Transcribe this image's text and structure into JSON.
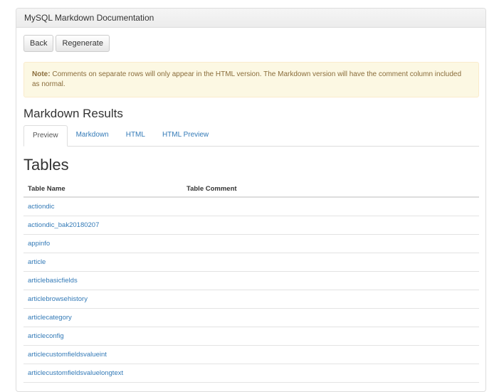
{
  "panel": {
    "title": "MySQL Markdown Documentation"
  },
  "buttons": {
    "back": "Back",
    "regenerate": "Regenerate"
  },
  "alert": {
    "label": "Note:",
    "text": " Comments on separate rows will only appear in the HTML version. The Markdown version will have the comment column included as normal."
  },
  "results": {
    "title": "Markdown Results",
    "tabs": [
      {
        "label": "Preview",
        "active": true
      },
      {
        "label": "Markdown",
        "active": false
      },
      {
        "label": "HTML",
        "active": false
      },
      {
        "label": "HTML Preview",
        "active": false
      }
    ]
  },
  "tables": {
    "title": "Tables",
    "columns": [
      "Table Name",
      "Table Comment"
    ],
    "rows": [
      {
        "name": "actiondic",
        "comment": ""
      },
      {
        "name": "actiondic_bak20180207",
        "comment": ""
      },
      {
        "name": "appinfo",
        "comment": ""
      },
      {
        "name": "article",
        "comment": ""
      },
      {
        "name": "articlebasicfields",
        "comment": ""
      },
      {
        "name": "articlebrowsehistory",
        "comment": ""
      },
      {
        "name": "articlecategory",
        "comment": ""
      },
      {
        "name": "articleconfig",
        "comment": ""
      },
      {
        "name": "articlecustomfieldsvalueint",
        "comment": ""
      },
      {
        "name": "articlecustomfieldsvaluelongtext",
        "comment": ""
      }
    ]
  },
  "colors": {
    "link": "#337ab7",
    "alert_bg": "#fcf8e3",
    "alert_text": "#8a6d3b"
  }
}
